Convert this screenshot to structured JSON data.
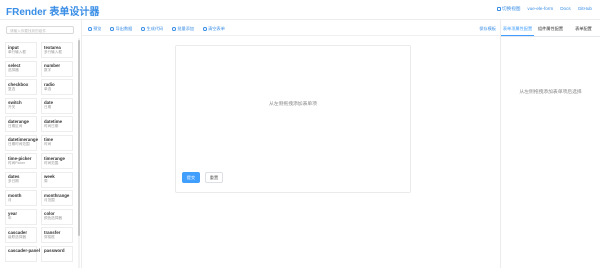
{
  "header": {
    "logo": "FRender 表单设计器",
    "links": [
      {
        "label": "切换视图",
        "icon": "view-icon"
      },
      {
        "label": "vue-ele-form"
      },
      {
        "label": "Docs"
      },
      {
        "label": "GitHub"
      }
    ]
  },
  "sidebar": {
    "search_placeholder": "请输入你要找到的组件",
    "components": [
      {
        "name": "input",
        "desc": "单行输入框"
      },
      {
        "name": "textarea",
        "desc": "多行输入框"
      },
      {
        "name": "select",
        "desc": "选择器"
      },
      {
        "name": "number",
        "desc": "数字"
      },
      {
        "name": "checkbox",
        "desc": "复选"
      },
      {
        "name": "radio",
        "desc": "单选"
      },
      {
        "name": "switch",
        "desc": "开关"
      },
      {
        "name": "date",
        "desc": "日期"
      },
      {
        "name": "daterange",
        "desc": "日期区间"
      },
      {
        "name": "datetime",
        "desc": "时间日期"
      },
      {
        "name": "datetimerange",
        "desc": "日期时间范围"
      },
      {
        "name": "time",
        "desc": "时间"
      },
      {
        "name": "time-picker",
        "desc": "时间Picker"
      },
      {
        "name": "timerange",
        "desc": "时间范围"
      },
      {
        "name": "dates",
        "desc": "多日期"
      },
      {
        "name": "week",
        "desc": "周"
      },
      {
        "name": "month",
        "desc": "月"
      },
      {
        "name": "monthrange",
        "desc": "月范围"
      },
      {
        "name": "year",
        "desc": "年"
      },
      {
        "name": "color",
        "desc": "颜色选择器"
      },
      {
        "name": "cascader",
        "desc": "级联选择器"
      },
      {
        "name": "transfer",
        "desc": "穿梭框"
      },
      {
        "name": "cascader-panel",
        "desc": ""
      },
      {
        "name": "password",
        "desc": ""
      }
    ]
  },
  "toolbar": {
    "items": [
      {
        "label": "预览",
        "icon": "preview-icon"
      },
      {
        "label": "导出数据",
        "icon": "export-icon"
      },
      {
        "label": "生成代码",
        "icon": "code-icon"
      },
      {
        "label": "批量添加",
        "icon": "add-icon"
      },
      {
        "label": "清空表单",
        "icon": "clear-icon"
      }
    ],
    "save_template": "保存模板"
  },
  "canvas": {
    "hint": "从左侧拖拽添加表单项",
    "submit_label": "提交",
    "reset_label": "重置"
  },
  "right_panel": {
    "tabs": [
      {
        "label": "表单项属性配置",
        "active": true
      },
      {
        "label": "组件属性配置",
        "active": false
      },
      {
        "label": "表单配置",
        "active": false
      }
    ],
    "hint": "从左侧拖拽添加表单项后选择"
  },
  "colors": {
    "accent": "#409eff",
    "logo": "#3a8ee6"
  }
}
